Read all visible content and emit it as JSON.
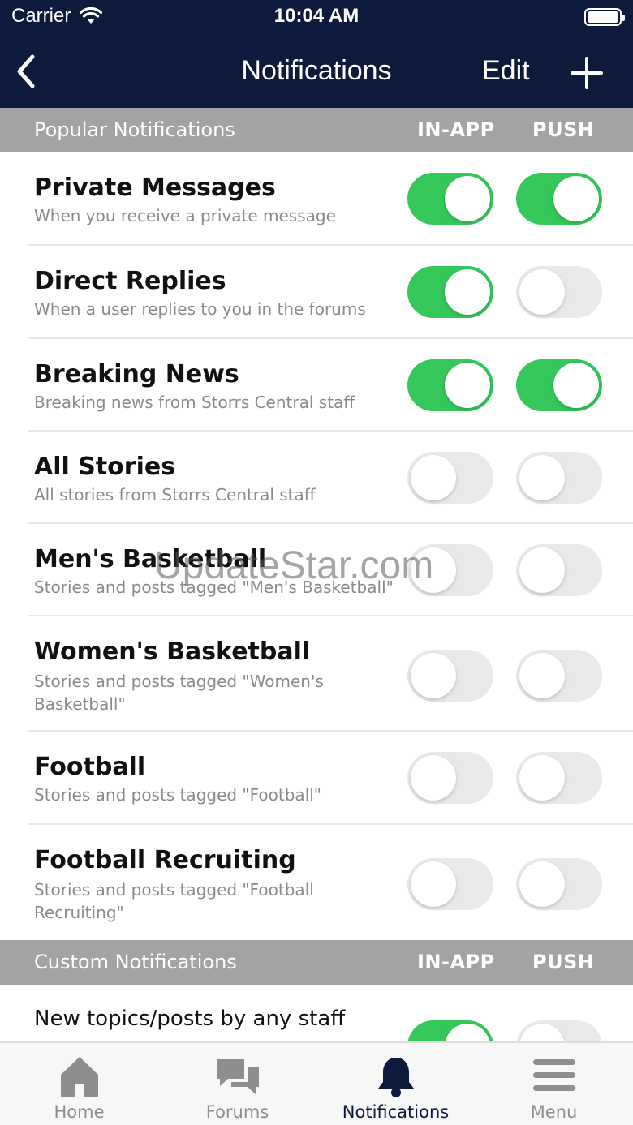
{
  "status_bar": {
    "carrier": "Carrier",
    "time": "10:04 AM"
  },
  "nav": {
    "title": "Notifications",
    "edit_label": "Edit"
  },
  "popular_section": {
    "title": "Popular Notifications",
    "in_app_label": "IN-APP",
    "push_label": "PUSH"
  },
  "popular_items": [
    {
      "title": "Private Messages",
      "subtitle": "When you receive a private message",
      "in_app": true,
      "push": true
    },
    {
      "title": "Direct Replies",
      "subtitle": "When a user replies to you in the forums",
      "in_app": true,
      "push": false
    },
    {
      "title": "Breaking News",
      "subtitle": "Breaking news from Storrs Central staff",
      "in_app": true,
      "push": true
    },
    {
      "title": "All Stories",
      "subtitle": "All stories from Storrs Central staff",
      "in_app": false,
      "push": false
    },
    {
      "title": "Men's Basketball",
      "subtitle": "Stories and posts tagged \"Men's Basketball\"",
      "in_app": false,
      "push": false
    },
    {
      "title": "Women's Basketball",
      "subtitle": "Stories and posts tagged \"Women's Basketball\"",
      "in_app": false,
      "push": false
    },
    {
      "title": "Football",
      "subtitle": "Stories and posts tagged \"Football\"",
      "in_app": false,
      "push": false
    },
    {
      "title": "Football Recruiting",
      "subtitle": "Stories and posts tagged \"Football Recruiting\"",
      "in_app": false,
      "push": false
    }
  ],
  "custom_section": {
    "title": "Custom Notifications",
    "in_app_label": "IN-APP",
    "push_label": "PUSH"
  },
  "custom_items": [
    {
      "title": "New topics/posts by any staff",
      "in_app": true,
      "push": false
    }
  ],
  "watermark": "UpdateStar.com",
  "tabs": [
    {
      "label": "Home",
      "icon": "home-icon",
      "active": false
    },
    {
      "label": "Forums",
      "icon": "chat-bubbles-icon",
      "active": false
    },
    {
      "label": "Notifications",
      "icon": "bell-icon",
      "active": true
    },
    {
      "label": "Menu",
      "icon": "hamburger-menu-icon",
      "active": false
    }
  ],
  "colors": {
    "nav_bg": "#0e1a3c",
    "toggle_on": "#35c759",
    "toggle_off": "#e9e9ea",
    "section_bg": "#a3a3a3"
  }
}
